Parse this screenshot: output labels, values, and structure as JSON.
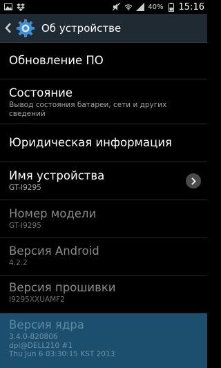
{
  "status_bar": {
    "icons_left": [
      "gallery-icon",
      "dropbox-icon"
    ],
    "icons_right": [
      "mute-icon",
      "wifi-icon",
      "signal-icon",
      "battery-icon"
    ],
    "battery_percent": "40%",
    "time": "15:16"
  },
  "action_bar": {
    "title": "Об устройстве",
    "icon": "settings-gear-icon",
    "back_icon": "back-chevron-icon"
  },
  "items": [
    {
      "title": "Обновление ПО",
      "subtitle": "",
      "enabled": true
    },
    {
      "title": "Состояние",
      "subtitle": "Вывод состояния батареи, сети и других сведений",
      "enabled": true
    },
    {
      "title": "Юридическая информация",
      "subtitle": "",
      "enabled": true
    },
    {
      "title": "Имя устройства",
      "subtitle": "GT-I9295",
      "enabled": true,
      "has_chevron": true
    },
    {
      "title": "Номер модели",
      "subtitle": "GT-I9295",
      "enabled": false
    },
    {
      "title": "Версия Android",
      "subtitle": "4.2.2",
      "enabled": false
    },
    {
      "title": "Версия прошивки",
      "subtitle": "I9295XXUAMF2",
      "enabled": false
    },
    {
      "title": "Версия ядра",
      "subtitle_lines": [
        "3.4.0-820806",
        "dpi@DELL210 #1",
        "Thu Jun 6 03:30:15 KST 2013"
      ],
      "enabled": false,
      "selected": true
    }
  ],
  "colors": {
    "action_bar_bg": "#1f2a33",
    "accent": "#3d8fd1",
    "selected_bg": "#1c4f6e",
    "disabled_text": "#8a8a8a"
  }
}
